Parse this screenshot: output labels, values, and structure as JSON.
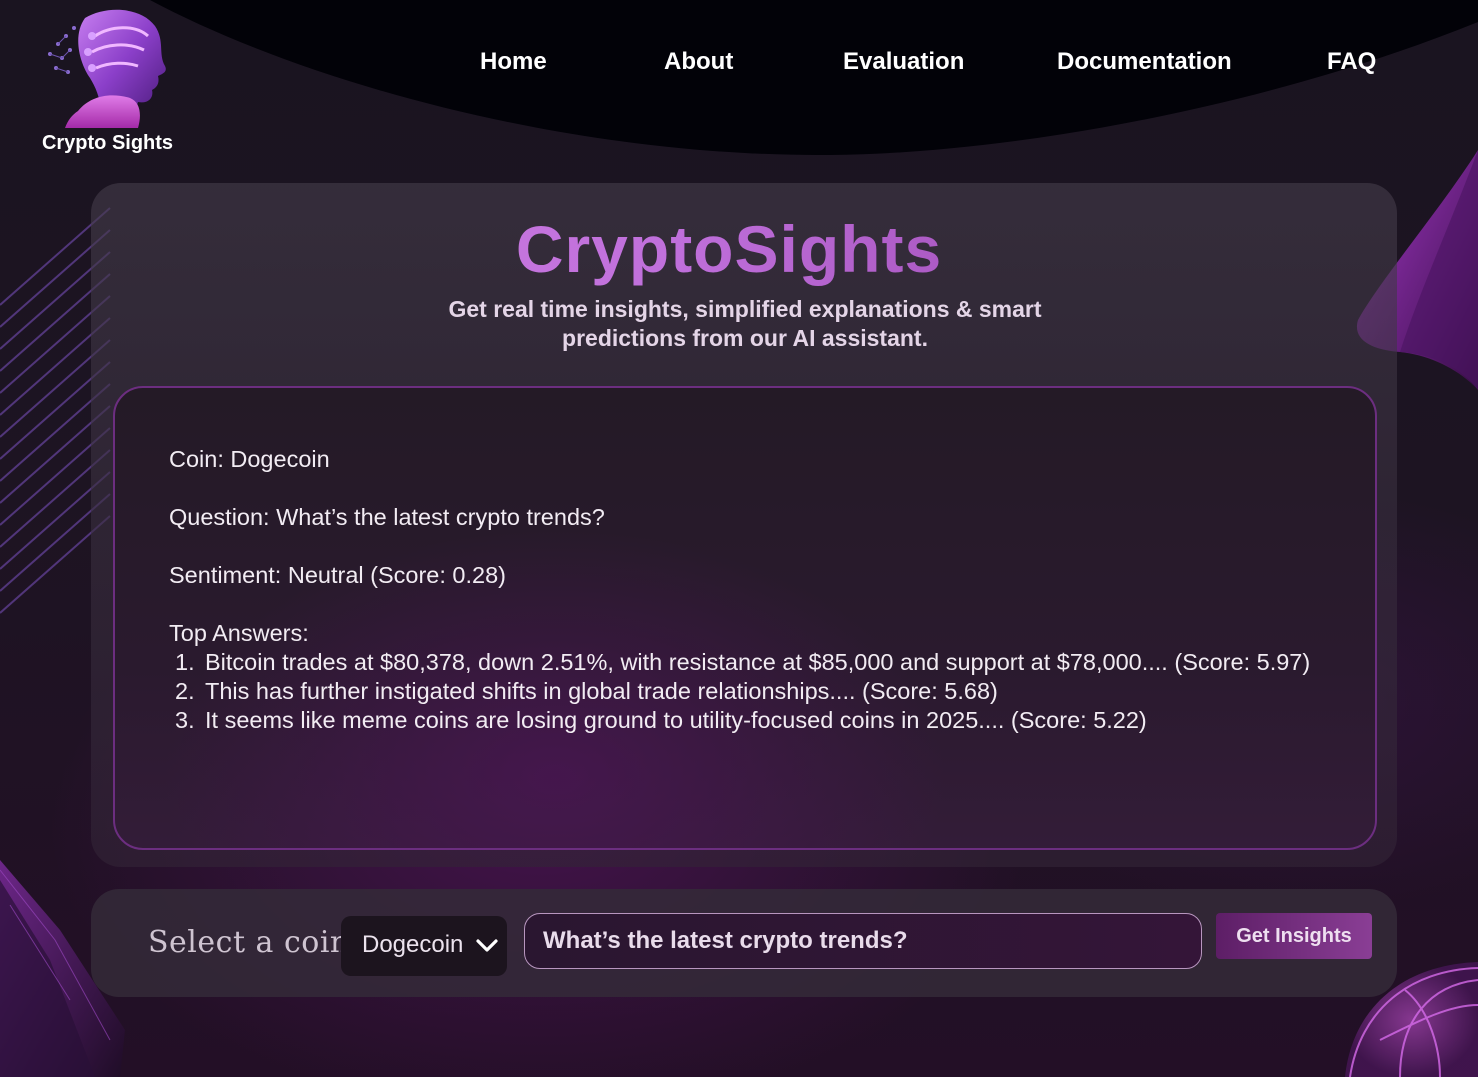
{
  "brand": {
    "logo_text": "Crypto Sights",
    "title": "CryptoSights",
    "subtitle": "Get real time insights, simplified explanations & smart predictions from our AI assistant."
  },
  "nav": {
    "items": [
      "Home",
      "About",
      "Evaluation",
      "Documentation",
      "FAQ"
    ]
  },
  "result": {
    "coin_line": "Coin: Dogecoin",
    "question_line": "Question: What’s the latest crypto trends?",
    "sentiment_line": "Sentiment: Neutral (Score: 0.28)",
    "answers_heading": "Top Answers:",
    "answers": [
      {
        "num": "1.",
        "text": "Bitcoin trades at $80,378, down 2.51%, with resistance at $85,000 and support at $78,000.... (Score: 5.97)"
      },
      {
        "num": "2.",
        "text": "This has further instigated shifts in global trade relationships.... (Score: 5.68)"
      },
      {
        "num": "3.",
        "text": "It seems like meme coins are losing ground to utility-focused coins in 2025.... (Score: 5.22)"
      }
    ]
  },
  "query": {
    "select_label": "Select a coin:",
    "selected_coin": "Dogecoin",
    "question_value": "What’s the latest crypto trends?",
    "button_label": "Get Insights"
  },
  "icons": {
    "logo": "robot-head-logo-icon",
    "dropdown": "chevron-down-icon"
  },
  "colors": {
    "accent": "#c070dc",
    "accent_dark": "#8f3aa1",
    "background": "#1d1422",
    "panel_border": "#6c2e80",
    "button": "#7a3585"
  }
}
